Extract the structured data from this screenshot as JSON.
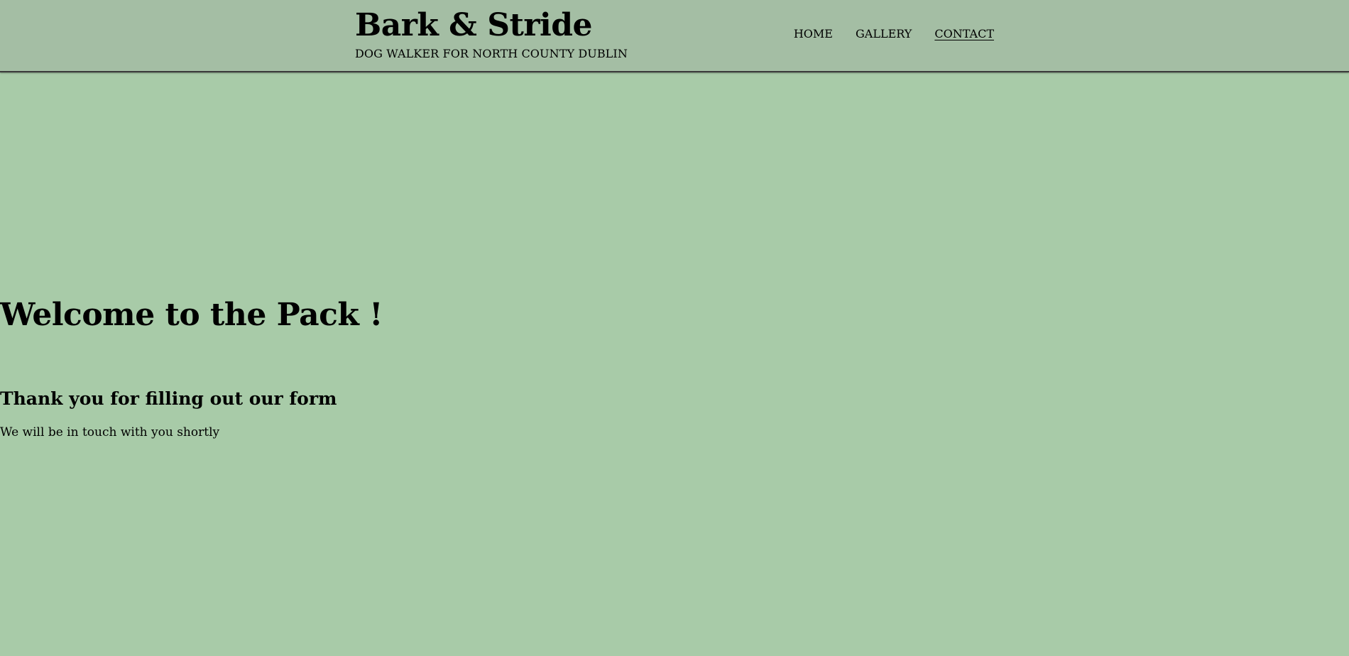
{
  "header": {
    "title": "Bark & Stride",
    "tagline": "DOG WALKER FOR NORTH COUNTY DUBLIN",
    "nav": [
      {
        "label": "HOME",
        "active": false
      },
      {
        "label": "GALLERY",
        "active": false
      },
      {
        "label": "CONTACT",
        "active": true
      }
    ]
  },
  "main": {
    "heading": "Welcome to the Pack !",
    "subheading": "Thank you for filling out our form",
    "message": "We will be in touch with you shortly"
  },
  "colors": {
    "page_background": "#a8cba8",
    "header_background": "#a4bea4",
    "text": "#000000"
  }
}
